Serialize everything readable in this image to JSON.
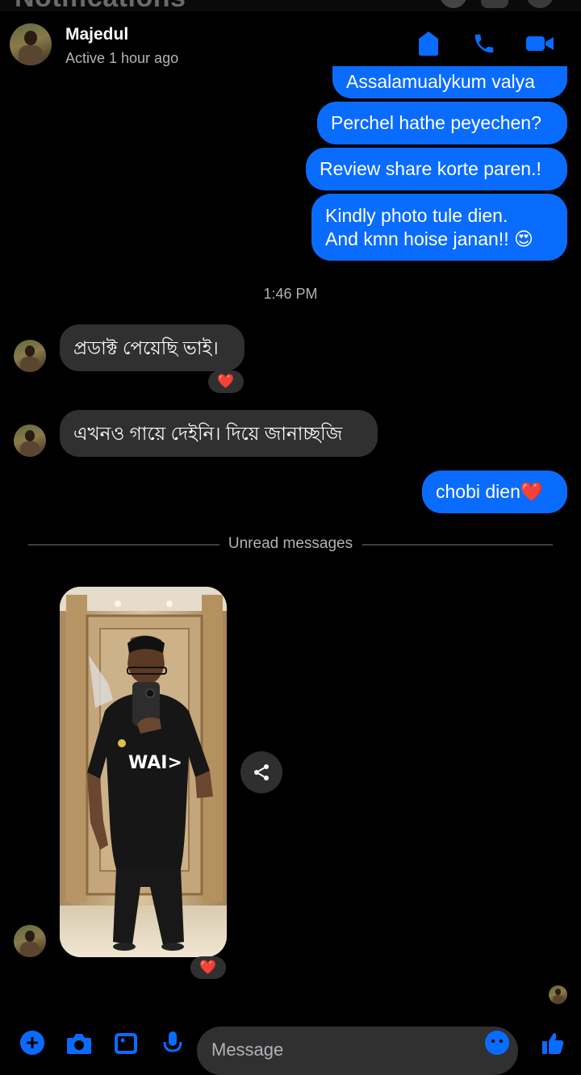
{
  "background_header": {
    "title": "Notifications"
  },
  "chat_header": {
    "name": "Majedul",
    "status": "Active 1 hour ago",
    "icons": [
      "shield-icon",
      "phone-icon",
      "video-camera-icon"
    ],
    "accent": "#0a6bff"
  },
  "messages": {
    "out_1": "Assalamualykum valya",
    "out_2": "Perchel hathe peyechen?",
    "out_3": "Review share korte paren.!",
    "out_4_line1": "Kindly photo tule dien.",
    "out_4_line2": "And kmn hoise janan!! 😍",
    "timestamp": "1:46 PM",
    "in_1": "প্রডাক্ট পেয়েছি ভাই।",
    "in_1_reaction": "❤️",
    "in_2": "এখনও গায়ে দেইনি। দিয়ে জানাচ্ছজি",
    "out_5": "chobi dien❤️",
    "unread_label": "Unread messages",
    "photo_reaction": "❤️",
    "photo_shirt_text": "WAI>"
  },
  "composer": {
    "placeholder": "Message",
    "icons": [
      "plus-icon",
      "camera-icon",
      "gallery-icon",
      "microphone-icon",
      "emoji-icon",
      "thumbs-up-icon"
    ]
  },
  "colors": {
    "outgoing_bubble": "#0a6bff",
    "incoming_bubble": "#303030",
    "background": "#000000",
    "secondary_text": "#b0b3b8"
  }
}
